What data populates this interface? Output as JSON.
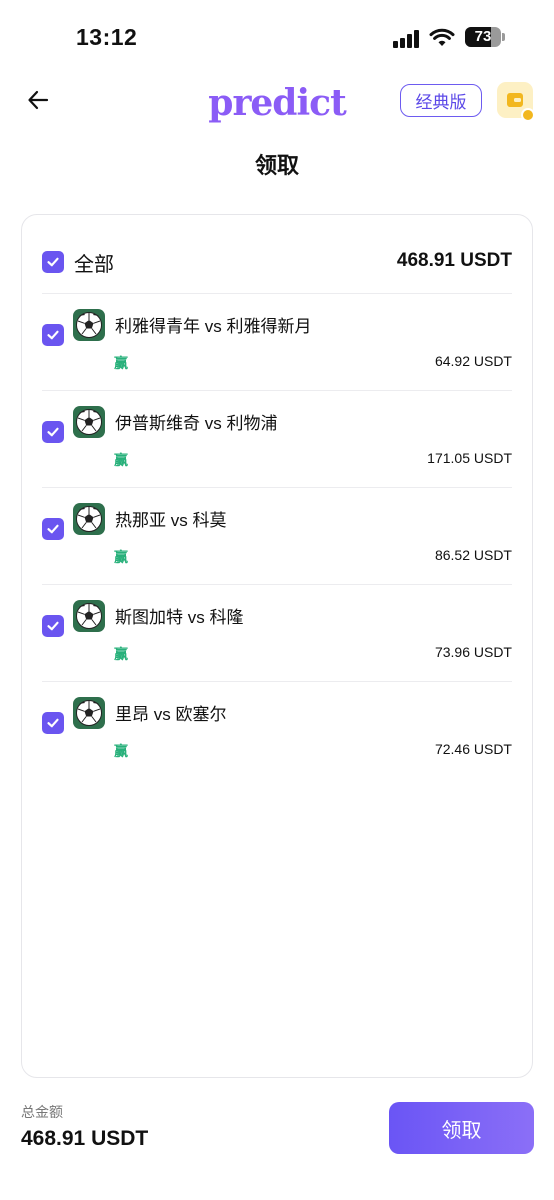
{
  "status_bar": {
    "time": "13:12",
    "battery": "73",
    "battery_level": 0.73
  },
  "header": {
    "logo": "predict",
    "classic_label": "经典版"
  },
  "page": {
    "title": "领取"
  },
  "select_all": {
    "label": "全部",
    "amount": "468.91 USDT",
    "checked": true
  },
  "matches": [
    {
      "title": "利雅得青年 vs 利雅得新月",
      "result": "赢",
      "amount": "64.92 USDT",
      "checked": true
    },
    {
      "title": "伊普斯维奇 vs 利物浦",
      "result": "赢",
      "amount": "171.05 USDT",
      "checked": true
    },
    {
      "title": "热那亚 vs 科莫",
      "result": "赢",
      "amount": "86.52 USDT",
      "checked": true
    },
    {
      "title": "斯图加特 vs 科隆",
      "result": "赢",
      "amount": "73.96 USDT",
      "checked": true
    },
    {
      "title": "里昂 vs 欧塞尔",
      "result": "赢",
      "amount": "72.46 USDT",
      "checked": true
    }
  ],
  "footer": {
    "total_label": "总金额",
    "total_amount": "468.91 USDT",
    "claim_label": "领取"
  },
  "colors": {
    "accent": "#6a55f0",
    "win": "#27b07a"
  },
  "icons": {
    "back": "arrow-left-icon",
    "wallet": "wallet-icon",
    "check": "check-icon",
    "match": "soccer-ball-icon"
  }
}
